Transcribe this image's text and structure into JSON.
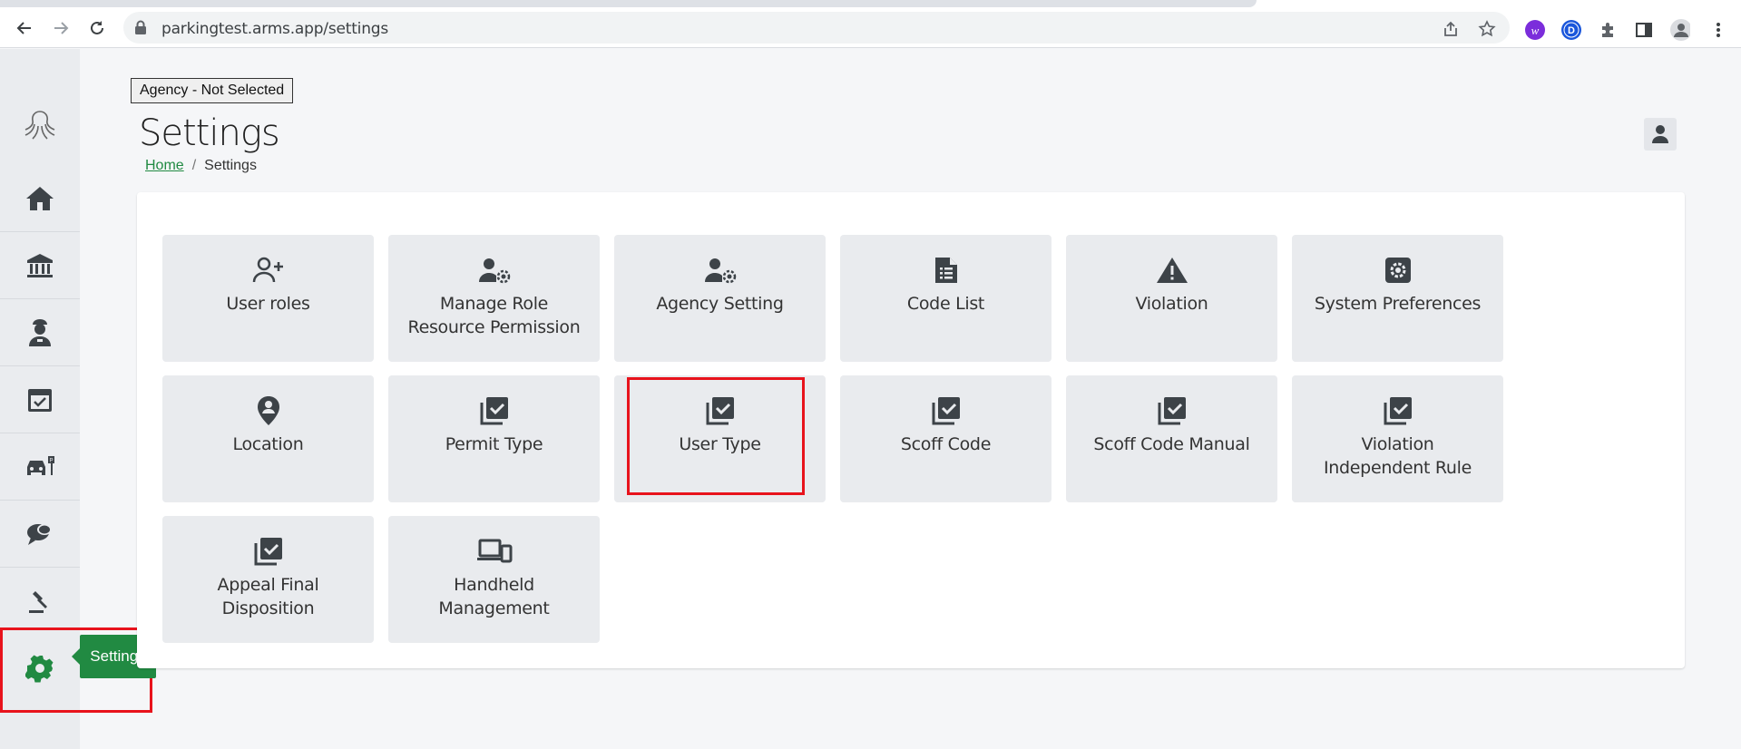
{
  "browser": {
    "url": "parkingtest.arms.app/settings",
    "extensions": [
      "w",
      "D"
    ]
  },
  "sidebar": {
    "items": [
      {
        "name": "logo",
        "icon": "octopus-logo-icon"
      },
      {
        "name": "home",
        "icon": "home-icon"
      },
      {
        "name": "agency",
        "icon": "bank-icon"
      },
      {
        "name": "officer",
        "icon": "officer-icon"
      },
      {
        "name": "calendar",
        "icon": "calendar-check-icon"
      },
      {
        "name": "vehicle",
        "icon": "car-parking-icon"
      },
      {
        "name": "chat",
        "icon": "chat-icon"
      },
      {
        "name": "gavel",
        "icon": "gavel-icon"
      },
      {
        "name": "settings",
        "icon": "gear-icon"
      }
    ],
    "tooltip": "Settings"
  },
  "header": {
    "agency_button": "Agency - Not Selected",
    "title": "Settings",
    "breadcrumb": {
      "home": "Home",
      "separator": "/",
      "current": "Settings"
    }
  },
  "tiles": [
    {
      "label": "User roles",
      "icon": "user-plus-icon"
    },
    {
      "label": "Manage Role Resource Permission",
      "icon": "user-gear-icon"
    },
    {
      "label": "Agency Setting",
      "icon": "user-gear-icon"
    },
    {
      "label": "Code List",
      "icon": "file-list-icon"
    },
    {
      "label": "Violation",
      "icon": "warning-icon"
    },
    {
      "label": "System Preferences",
      "icon": "gear-square-icon"
    },
    {
      "label": "Location",
      "icon": "location-pin-icon"
    },
    {
      "label": "Permit Type",
      "icon": "checklist-icon"
    },
    {
      "label": "User Type",
      "icon": "checklist-icon"
    },
    {
      "label": "Scoff Code",
      "icon": "checklist-icon"
    },
    {
      "label": "Scoff Code Manual",
      "icon": "checklist-icon"
    },
    {
      "label": "Violation Independent Rule",
      "icon": "checklist-icon"
    },
    {
      "label": "Appeal Final Disposition",
      "icon": "checklist-icon"
    },
    {
      "label": "Handheld Management",
      "icon": "devices-icon"
    }
  ],
  "colors": {
    "accent": "#218a42",
    "highlight": "#e8131c",
    "icon": "#3d4348"
  }
}
